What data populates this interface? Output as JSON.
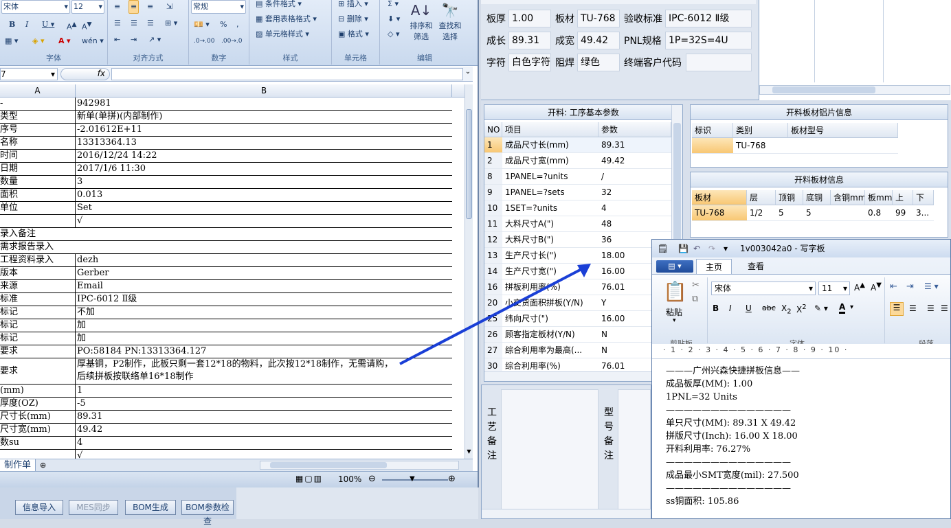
{
  "excel": {
    "ribbon": {
      "font_name": "宋体",
      "font_size": "12",
      "number_format": "常规",
      "cond_format": "条件格式",
      "table_format": "套用表格格式",
      "cell_style": "单元格样式",
      "insert": "插入",
      "delete": "删除",
      "format": "格式",
      "sort_filter": "排序和\n筛选",
      "find_select": "查找和\n选择",
      "group_font": "字体",
      "group_align": "对齐方式",
      "group_number": "数字",
      "group_style": "样式",
      "group_cells": "单元格",
      "group_edit": "编辑",
      "percent": "%",
      "comma": ","
    },
    "name_box": "7",
    "fx": "fx",
    "col_a": "A",
    "col_b": "B",
    "rows": [
      {
        "a": "-",
        "b": "942981"
      },
      {
        "a": "类型",
        "b": "新单(单拼)(内部制作)"
      },
      {
        "a": "序号",
        "b": "-2.01612E+11"
      },
      {
        "a": "名称",
        "b": "13313364.13"
      },
      {
        "a": "时间",
        "b": "2016/12/24 14:22"
      },
      {
        "a": "日期",
        "b": "2017/1/6 11:30"
      },
      {
        "a": "数量",
        "b": "3"
      },
      {
        "a": "面积",
        "b": "0.013"
      },
      {
        "a": "单位",
        "b": "Set"
      },
      {
        "a": "",
        "b": "√"
      },
      {
        "a": "录入备注",
        "b": ""
      },
      {
        "a": "需求报告录入",
        "b": ""
      },
      {
        "a": "工程资料录入",
        "b": "dezh"
      },
      {
        "a": "版本",
        "b": "Gerber"
      },
      {
        "a": "来源",
        "b": "Email"
      },
      {
        "a": "标准",
        "b": "IPC-6012 Ⅱ级"
      },
      {
        "a": "标记",
        "b": "不加"
      },
      {
        "a": "标记",
        "b": "加"
      },
      {
        "a": "标记",
        "b": "加"
      },
      {
        "a": "要求",
        "b": "PO:58184 PN:13313364.127"
      },
      {
        "a": "要求",
        "b": "厚基铜，P2制作，此板只剩一套12*18的物料，此次按12*18制作，无需请购，\n后续拼板按联络单16*18制作"
      },
      {
        "a": "(mm)",
        "b": "1"
      },
      {
        "a": "厚度(OZ)",
        "b": "-5"
      },
      {
        "a": "尺寸长(mm)",
        "b": "89.31"
      },
      {
        "a": "尺寸宽(mm)",
        "b": "49.42"
      },
      {
        "a": "数su",
        "b": "4"
      },
      {
        "a": "",
        "b": "√"
      }
    ],
    "sheet_tab": "制作单",
    "zoom": "100%"
  },
  "taskbar": {
    "info_import": "信息导入",
    "mes_sync": "MES同步",
    "bom_gen": "BOM生成",
    "bom_check": "BOM参数检查"
  },
  "app": {
    "fields": {
      "thickness_label": "板厚",
      "thickness": "1.00",
      "material_label": "板材",
      "material": "TU-768",
      "accept_label": "验收标准",
      "accept": "IPC-6012 Ⅱ级",
      "length_label": "成长",
      "length": "89.31",
      "width_label": "成宽",
      "width": "49.42",
      "pnl_label": "PNL规格",
      "pnl": "1P=32S=4U",
      "char_label": "字符",
      "char": "白色字符",
      "mask_label": "阻焊",
      "mask": "绿色",
      "customer_label": "终端客户代码",
      "customer": ""
    },
    "params": {
      "title": "开料: 工序基本参数",
      "headers": [
        "NO",
        "项目",
        "参数"
      ],
      "rows": [
        {
          "no": "1",
          "item": "成品尺寸长(mm)",
          "val": "89.31"
        },
        {
          "no": "2",
          "item": "成品尺寸宽(mm)",
          "val": "49.42"
        },
        {
          "no": "8",
          "item": "1PANEL=?units",
          "val": "/"
        },
        {
          "no": "9",
          "item": "1PANEL=?sets",
          "val": "32"
        },
        {
          "no": "10",
          "item": "1SET=?units",
          "val": "4"
        },
        {
          "no": "11",
          "item": "大料尺寸A(\")",
          "val": "48"
        },
        {
          "no": "12",
          "item": "大料尺寸B(\")",
          "val": "36"
        },
        {
          "no": "13",
          "item": "生产尺寸长(\")",
          "val": "18.00"
        },
        {
          "no": "14",
          "item": "生产尺寸宽(\")",
          "val": "16.00"
        },
        {
          "no": "16",
          "item": "拼板利用率(%)",
          "val": "76.01"
        },
        {
          "no": "20",
          "item": "小交货面积拼板(Y/N)",
          "val": "Y"
        },
        {
          "no": "25",
          "item": "纬向尺寸(\")",
          "val": "16.00"
        },
        {
          "no": "26",
          "item": "顾客指定板材(Y/N)",
          "val": "N"
        },
        {
          "no": "27",
          "item": "综合利用率为最高(...",
          "val": "N"
        },
        {
          "no": "30",
          "item": "综合利用率(%)",
          "val": "76.01"
        }
      ]
    },
    "sheet_info": {
      "title": "开料板材铝片信息",
      "headers": [
        "标识",
        "类别",
        "板材型号"
      ],
      "row": [
        "",
        "TU-768",
        ""
      ]
    },
    "board_info": {
      "title": "开料板材信息",
      "headers": [
        "板材",
        "层",
        "顶铜",
        "底铜",
        "含铜mm",
        "板mm",
        "上",
        "下"
      ],
      "row": [
        "TU-768",
        "1/2",
        "5",
        "5",
        "",
        "0.8",
        "99",
        "3..."
      ]
    },
    "process_note": "工\n艺\n备\n注",
    "model_note": "型\n号\n备\n注"
  },
  "wordpad": {
    "title": "1v003042a0 - 写字板",
    "tab_home": "主页",
    "tab_view": "查看",
    "paste": "粘贴",
    "font_name": "宋体",
    "font_size": "11",
    "group_clip": "剪贴板",
    "group_font": "字体",
    "group_para": "段落",
    "ruler": "· 1 · 2 · 3 · 4 · 5 · 6 · 7 · 8 · 9 · 10 ·",
    "lines": [
      "———广州兴森快捷拼板信息——",
      "成品板厚(MM): 1.00",
      "1PNL=32 Units",
      "——————————————",
      "单只尺寸(MM): 89.31 X 49.42",
      "拼版尺寸(Inch): 16.00 X 18.00",
      "开料利用率: 76.27%",
      "——————————————",
      "成品最小SMT宽度(mil): 27.500",
      "——————————————",
      "ss铜面积: 105.86"
    ]
  },
  "colors": {
    "accent": "#1a3fd6",
    "selected": "#fbd08a",
    "header": "#dfe7f2"
  }
}
